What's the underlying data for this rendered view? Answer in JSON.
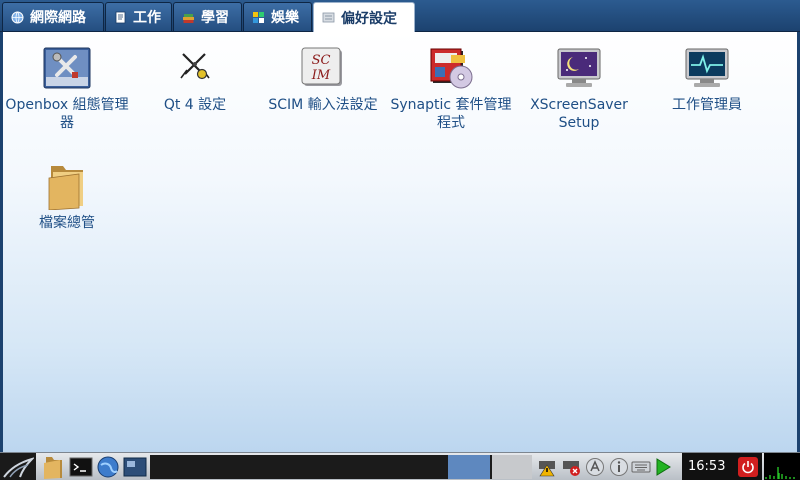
{
  "tabs": [
    {
      "label": "網際網路",
      "icon": "globe-icon"
    },
    {
      "label": "工作",
      "icon": "document-icon"
    },
    {
      "label": "學習",
      "icon": "books-icon"
    },
    {
      "label": "娛樂",
      "icon": "media-icon"
    },
    {
      "label": "偏好設定",
      "icon": "settings-icon",
      "active": true
    }
  ],
  "apps": [
    {
      "label": "Openbox 組態管理器",
      "icon": "tools-icon"
    },
    {
      "label": "Qt 4 設定",
      "icon": "compass-icon"
    },
    {
      "label": "SCIM 輸入法設定",
      "icon": "scim-icon",
      "icon_text": [
        "SC",
        "IM"
      ]
    },
    {
      "label": "Synaptic 套件管理程式",
      "icon": "package-manager-icon"
    },
    {
      "label": "XScreenSaver Setup",
      "icon": "screensaver-icon"
    },
    {
      "label": "工作管理員",
      "icon": "task-manager-icon"
    },
    {
      "label": "檔案總管",
      "icon": "folder-icon"
    }
  ],
  "taskbar": {
    "clock": "16:53",
    "start_icon": "launcher-icon",
    "quicklaunch": [
      "folder-icon",
      "terminal-icon",
      "browser-icon",
      "desktop-icon"
    ],
    "tray": [
      "network-warning-icon",
      "network-error-icon",
      "input-method-icon",
      "info-icon",
      "keyboard-icon",
      "play-icon"
    ],
    "power_icon": "power-icon",
    "cpu_graph": "cpu-monitor-icon"
  },
  "colors": {
    "tab_bar": "#244e80",
    "active_tab": "#ffffff",
    "label_text": "#1f4f86",
    "taskbar": "#c9cdd2"
  }
}
